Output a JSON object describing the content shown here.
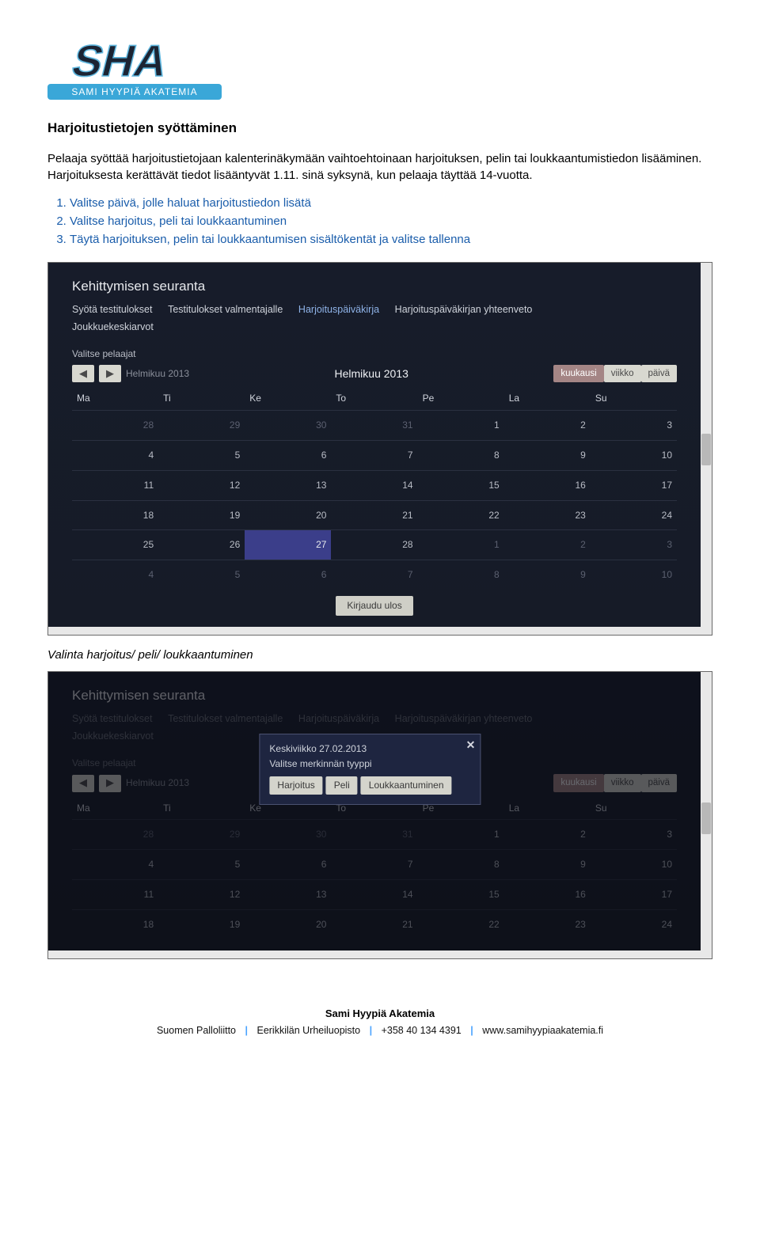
{
  "logo": {
    "text_top": "SHA",
    "text_band": "SAMI HYYPIÄ AKATEMIA"
  },
  "heading": "Harjoitustietojen syöttäminen",
  "paragraph": "Pelaaja syöttää harjoitustietojaan kalenterinäkymään vaihtoehtoinaan harjoituksen, pelin tai loukkaantumistiedon lisääminen. Harjoituksesta kerättävät tiedot lisääntyvät 1.11. sinä syksynä, kun pelaaja täyttää 14-vuotta.",
  "steps": [
    "Valitse päivä, jolle haluat harjoitustiedon lisätä",
    "Valitse harjoitus, peli tai loukkaantuminen",
    "Täytä harjoituksen, pelin tai loukkaantumisen sisältökentät ja valitse tallenna"
  ],
  "app1": {
    "title": "Kehittymisen seuranta",
    "tabs": [
      "Syötä testitulokset",
      "Testitulokset valmentajalle",
      "Harjoituspäiväkirja",
      "Harjoituspäiväkirjan yhteenveto"
    ],
    "tabs_row2": [
      "Joukkuekeskiarvot"
    ],
    "active_tab_index": 2,
    "select_label": "Valitse pelaajat",
    "nav_month_inline": "Helmikuu 2013",
    "center_month": "Helmikuu 2013",
    "views": [
      "kuukausi",
      "viikko",
      "päivä"
    ],
    "active_view_index": 0,
    "day_headers": [
      "Ma",
      "Ti",
      "Ke",
      "To",
      "Pe",
      "La",
      "Su"
    ],
    "weeks": [
      [
        {
          "n": "28",
          "dim": true
        },
        {
          "n": "29",
          "dim": true
        },
        {
          "n": "30",
          "dim": true
        },
        {
          "n": "31",
          "dim": true
        },
        {
          "n": "1"
        },
        {
          "n": "2"
        },
        {
          "n": "3"
        }
      ],
      [
        {
          "n": "4"
        },
        {
          "n": "5"
        },
        {
          "n": "6"
        },
        {
          "n": "7"
        },
        {
          "n": "8"
        },
        {
          "n": "9"
        },
        {
          "n": "10"
        }
      ],
      [
        {
          "n": "11"
        },
        {
          "n": "12"
        },
        {
          "n": "13"
        },
        {
          "n": "14"
        },
        {
          "n": "15"
        },
        {
          "n": "16"
        },
        {
          "n": "17"
        }
      ],
      [
        {
          "n": "18"
        },
        {
          "n": "19"
        },
        {
          "n": "20"
        },
        {
          "n": "21"
        },
        {
          "n": "22"
        },
        {
          "n": "23"
        },
        {
          "n": "24"
        }
      ],
      [
        {
          "n": "25"
        },
        {
          "n": "26"
        },
        {
          "n": "27",
          "selected": true
        },
        {
          "n": "28"
        },
        {
          "n": "1",
          "dim": true
        },
        {
          "n": "2",
          "dim": true
        },
        {
          "n": "3",
          "dim": true
        }
      ],
      [
        {
          "n": "4",
          "dim": true
        },
        {
          "n": "5",
          "dim": true
        },
        {
          "n": "6",
          "dim": true
        },
        {
          "n": "7",
          "dim": true
        },
        {
          "n": "8",
          "dim": true
        },
        {
          "n": "9",
          "dim": true
        },
        {
          "n": "10",
          "dim": true
        }
      ]
    ],
    "logout": "Kirjaudu ulos"
  },
  "caption2": "Valinta harjoitus/ peli/ loukkaantuminen",
  "app2": {
    "title": "Kehittymisen seuranta",
    "tabs": [
      "Syötä testitulokset",
      "Testitulokset valmentajalle",
      "Harjoituspäiväkirja",
      "Harjoituspäiväkirjan yhteenveto"
    ],
    "tabs_row2": [
      "Joukkuekeskiarvot"
    ],
    "select_label": "Valitse pelaajat",
    "nav_month_inline": "Helmikuu 2013",
    "views": [
      "kuukausi",
      "viikko",
      "päivä"
    ],
    "active_view_index": 0,
    "day_headers": [
      "Ma",
      "Ti",
      "Ke",
      "To",
      "Pe",
      "La",
      "Su"
    ],
    "weeks": [
      [
        {
          "n": "28",
          "dim": true
        },
        {
          "n": "29",
          "dim": true
        },
        {
          "n": "30",
          "dim": true
        },
        {
          "n": "31",
          "dim": true
        },
        {
          "n": "1"
        },
        {
          "n": "2"
        },
        {
          "n": "3"
        }
      ],
      [
        {
          "n": "4"
        },
        {
          "n": "5"
        },
        {
          "n": "6"
        },
        {
          "n": "7"
        },
        {
          "n": "8"
        },
        {
          "n": "9"
        },
        {
          "n": "10"
        }
      ],
      [
        {
          "n": "11"
        },
        {
          "n": "12"
        },
        {
          "n": "13"
        },
        {
          "n": "14"
        },
        {
          "n": "15"
        },
        {
          "n": "16"
        },
        {
          "n": "17"
        }
      ],
      [
        {
          "n": "18"
        },
        {
          "n": "19"
        },
        {
          "n": "20"
        },
        {
          "n": "21"
        },
        {
          "n": "22"
        },
        {
          "n": "23"
        },
        {
          "n": "24"
        }
      ]
    ],
    "popup": {
      "date": "Keskiviikko 27.02.2013",
      "sub": "Valitse merkinnän tyyppi",
      "buttons": [
        "Harjoitus",
        "Peli",
        "Loukkaantuminen"
      ]
    }
  },
  "footer": {
    "title": "Sami Hyypiä Akatemia",
    "parts": [
      "Suomen Palloliitto",
      "Eerikkilän Urheiluopisto",
      "+358 40 134 4391",
      "www.samihyypiaakatemia.fi"
    ]
  }
}
